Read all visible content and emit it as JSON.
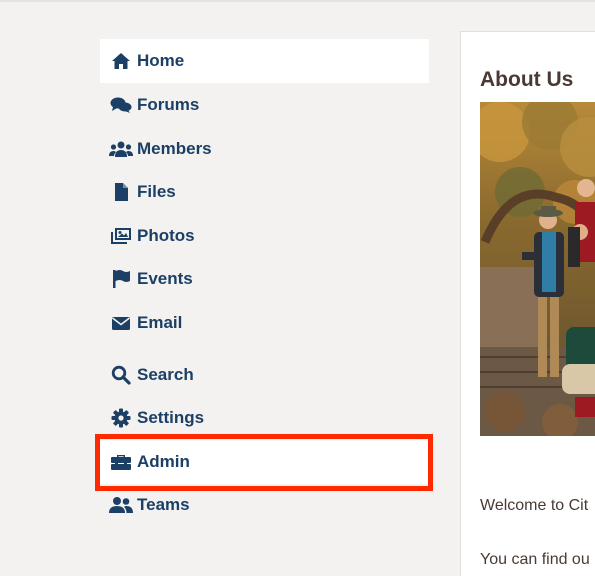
{
  "nav": {
    "items": [
      {
        "label": "Home",
        "icon": "home-icon"
      },
      {
        "label": "Forums",
        "icon": "forums-icon"
      },
      {
        "label": "Members",
        "icon": "members-icon"
      },
      {
        "label": "Files",
        "icon": "file-icon"
      },
      {
        "label": "Photos",
        "icon": "photos-icon"
      },
      {
        "label": "Events",
        "icon": "flag-icon"
      },
      {
        "label": "Email",
        "icon": "envelope-icon"
      },
      {
        "label": "Search",
        "icon": "search-icon"
      },
      {
        "label": "Settings",
        "icon": "gear-icon"
      },
      {
        "label": "Admin",
        "icon": "toolbox-icon"
      },
      {
        "label": "Teams",
        "icon": "teams-icon"
      }
    ],
    "active": "Home",
    "highlighted": "Admin"
  },
  "content": {
    "title": "About Us",
    "paragraph_1": "Welcome to Cit",
    "paragraph_2": "You can find ou"
  },
  "colors": {
    "nav_text": "#1c3f66",
    "highlight_border": "#ff2a00",
    "page_bg": "#f4f2f0",
    "heading": "#4a3a33"
  }
}
